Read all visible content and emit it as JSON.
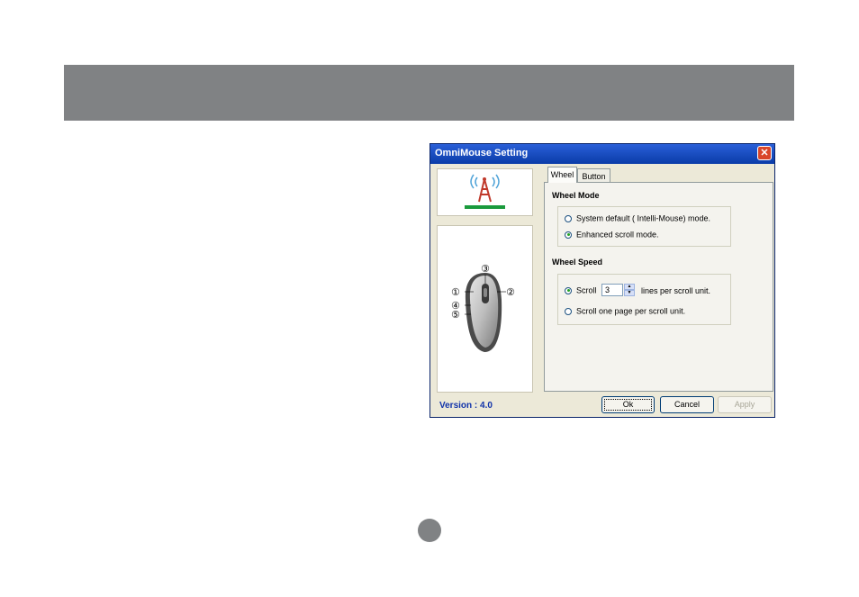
{
  "window": {
    "title": "OmniMouse Setting",
    "close_glyph": "✕",
    "version_text": "Version : 4.0"
  },
  "tabs": [
    {
      "label": "Wheel",
      "selected": true
    },
    {
      "label": "Button",
      "selected": false
    }
  ],
  "wheel_mode": {
    "title": "Wheel Mode",
    "options": [
      {
        "label": "System default ( Intelli-Mouse) mode.",
        "checked": false
      },
      {
        "label": "Enhanced scroll mode.",
        "checked": true
      }
    ]
  },
  "wheel_speed": {
    "title": "Wheel Speed",
    "scroll_label": "Scroll",
    "scroll_value": "3",
    "lines_suffix": "lines per scroll unit.",
    "page_option": "Scroll one page per scroll unit.",
    "scroll_lines_checked": true
  },
  "mouse_callouts": [
    "③",
    "①",
    "②",
    "④",
    "⑤"
  ],
  "buttons": {
    "ok": "Ok",
    "cancel": "Cancel",
    "apply": "Apply"
  },
  "colors": {
    "banner": "#808284",
    "titlebar": "#0a3ca8",
    "version": "#1133aa",
    "logo_bar": "#1a9a3c",
    "logo_signal": "#4fa3d8",
    "logo_tower": "#c0392b"
  },
  "icons": {
    "logo": "signal-tower-icon",
    "mouse": "mouse-illustration-icon"
  }
}
